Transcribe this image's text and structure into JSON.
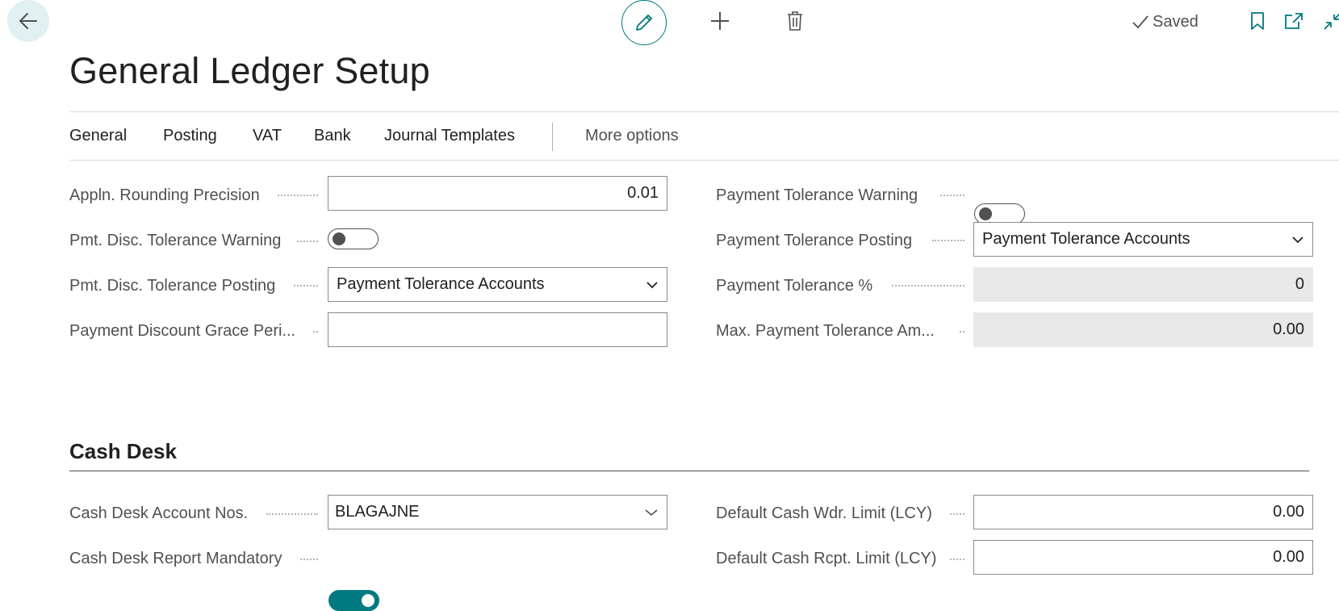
{
  "toolbar": {
    "saved_label": "Saved"
  },
  "page": {
    "title": "General Ledger Setup"
  },
  "tabs": [
    {
      "label": "General"
    },
    {
      "label": "Posting"
    },
    {
      "label": "VAT"
    },
    {
      "label": "Bank"
    },
    {
      "label": "Journal Templates"
    }
  ],
  "more_options": "More options",
  "fields": {
    "appln_rounding_precision": {
      "label": "Appln. Rounding Precision",
      "value": "0.01"
    },
    "pmt_disc_tolerance_warning": {
      "label": "Pmt. Disc. Tolerance Warning",
      "on": false
    },
    "pmt_disc_tolerance_posting": {
      "label": "Pmt. Disc. Tolerance Posting",
      "value": "Payment Tolerance Accounts"
    },
    "payment_discount_grace_period": {
      "label": "Payment Discount Grace Peri...",
      "value": ""
    },
    "payment_tolerance_warning": {
      "label": "Payment Tolerance Warning",
      "on": false
    },
    "payment_tolerance_posting": {
      "label": "Payment Tolerance Posting",
      "value": "Payment Tolerance Accounts"
    },
    "payment_tolerance_pct": {
      "label": "Payment Tolerance %",
      "value": "0"
    },
    "max_payment_tolerance_amount": {
      "label": "Max. Payment Tolerance Am...",
      "value": "0.00"
    }
  },
  "cash_desk": {
    "title": "Cash Desk",
    "account_nos": {
      "label": "Cash Desk Account Nos.",
      "value": "BLAGAJNE"
    },
    "report_mandatory": {
      "label": "Cash Desk Report Mandatory",
      "on": true
    },
    "default_wdr_limit": {
      "label": "Default Cash Wdr. Limit (LCY)",
      "value": "0.00"
    },
    "default_rcpt_limit": {
      "label": "Default Cash Rcpt. Limit (LCY)",
      "value": "0.00"
    }
  },
  "colors": {
    "accent": "#007a80",
    "readonly_bg": "#e8e8e8"
  },
  "icons": [
    "back-arrow-icon",
    "pencil-icon",
    "plus-icon",
    "trash-icon",
    "checkmark-icon",
    "bookmark-icon",
    "popout-icon",
    "collapse-icon",
    "chevron-down-icon"
  ]
}
